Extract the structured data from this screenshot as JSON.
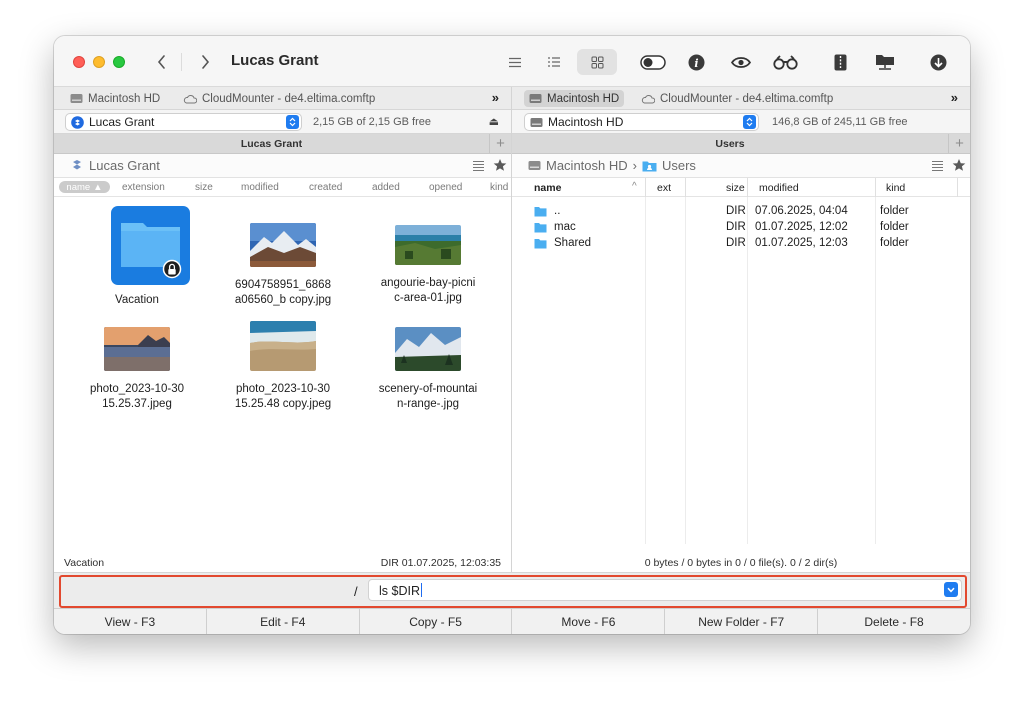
{
  "window": {
    "title": "Lucas Grant"
  },
  "toolbar": {
    "icons": [
      "menu-icon",
      "list-view-icon",
      "icon-view-icon",
      "toggle-icon",
      "info-icon",
      "eye-icon",
      "binoculars-icon",
      "archive-icon",
      "network-folder-icon",
      "download-icon"
    ]
  },
  "left": {
    "tabs": [
      {
        "label": "Macintosh HD",
        "icon": "drive-icon"
      },
      {
        "label": "CloudMounter - de4.eltima.comftp",
        "icon": "cloud-icon"
      }
    ],
    "tabs_more": "»",
    "volume": {
      "label": "Lucas Grant",
      "free": "2,15 GB of 2,15 GB free",
      "eject": "⏏"
    },
    "pane_title": "Lucas Grant",
    "plus": "+",
    "path": [
      "Lucas Grant"
    ],
    "columns": [
      "name",
      "extension",
      "size",
      "modified",
      "created",
      "added",
      "opened",
      "kind"
    ],
    "sort_marker": "▲",
    "items": [
      {
        "name": "Vacation",
        "type": "folder"
      },
      {
        "name": "6904758951_6868\na06560_b copy.jpg",
        "type": "image"
      },
      {
        "name": "angourie-bay-picni\nc-area-01.jpg",
        "type": "image"
      },
      {
        "name": "photo_2023-10-30\n15.25.37.jpeg",
        "type": "image"
      },
      {
        "name": "photo_2023-10-30\n15.25.48 copy.jpeg",
        "type": "image"
      },
      {
        "name": "scenery-of-mountai\nn-range-.jpg",
        "type": "image"
      }
    ],
    "status": {
      "name": "Vacation",
      "info": "DIR  01.07.2025, 12:03:35"
    }
  },
  "right": {
    "tabs": [
      {
        "label": "Macintosh HD",
        "icon": "drive-icon"
      },
      {
        "label": "CloudMounter - de4.eltima.comftp",
        "icon": "cloud-icon"
      }
    ],
    "tabs_more": "»",
    "volume": {
      "label": "Macintosh HD",
      "free": "146,8 GB of 245,11 GB free"
    },
    "pane_title": "Users",
    "plus": "+",
    "path": [
      "Macintosh HD",
      "›",
      "Users"
    ],
    "columns": {
      "name": "name",
      "ext": "ext",
      "size": "size",
      "modified": "modified",
      "kind": "kind"
    },
    "rows": [
      {
        "name": "..",
        "size": "DIR",
        "modified": "07.06.2025, 04:04",
        "kind": "folder"
      },
      {
        "name": "mac",
        "size": "DIR",
        "modified": "01.07.2025, 12:02",
        "kind": "folder"
      },
      {
        "name": "Shared",
        "size": "DIR",
        "modified": "01.07.2025, 12:03",
        "kind": "folder"
      }
    ],
    "status": "0 bytes / 0 bytes in 0 / 0 file(s). 0 / 2 dir(s)"
  },
  "command": {
    "prompt": "/",
    "value": "ls $DIR"
  },
  "fkeys": [
    "View - F3",
    "Edit - F4",
    "Copy - F5",
    "Move - F6",
    "New Folder - F7",
    "Delete - F8"
  ],
  "colors": {
    "accent": "#1f7cf0",
    "highlight": "#e2492f",
    "folder": "#5bb4f5"
  }
}
